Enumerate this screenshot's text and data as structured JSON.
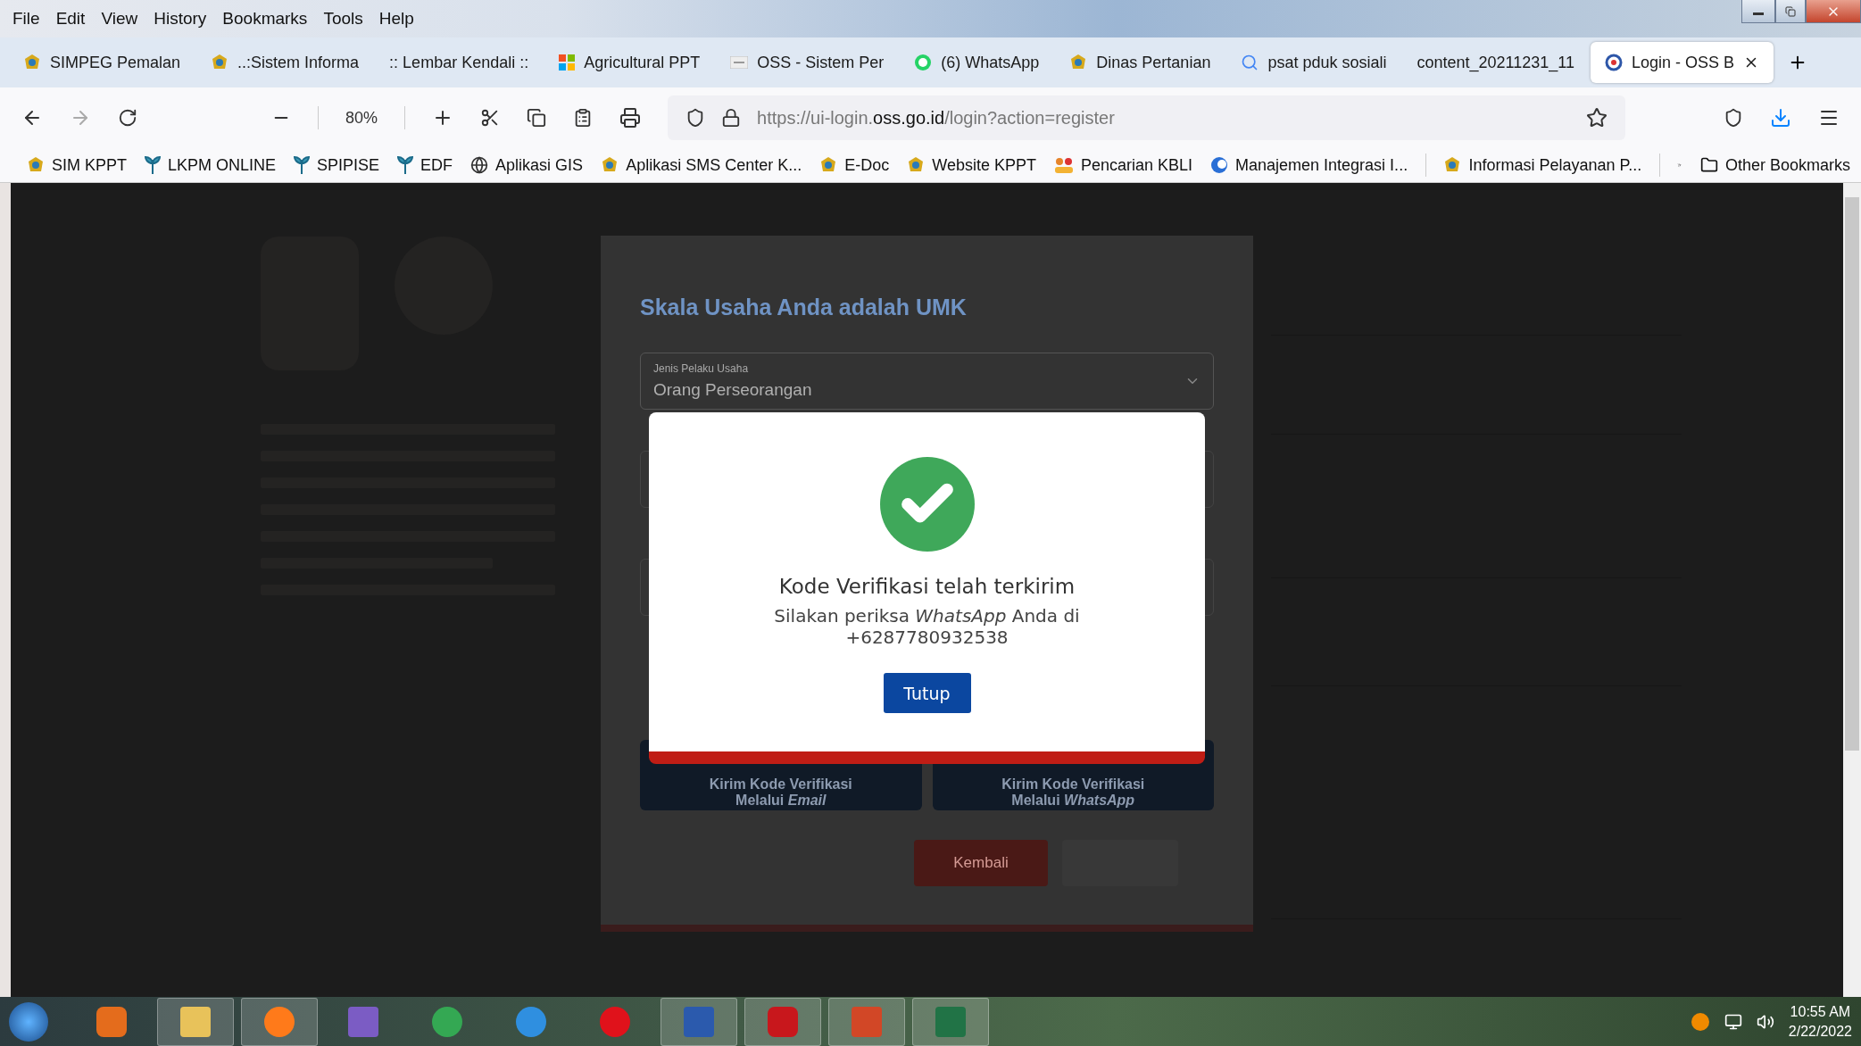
{
  "menu": [
    "File",
    "Edit",
    "View",
    "History",
    "Bookmarks",
    "Tools",
    "Help"
  ],
  "tabs": [
    {
      "label": "SIMPEG Pemalan",
      "selected": false
    },
    {
      "label": "..:Sistem Informa",
      "selected": false
    },
    {
      "label": ":: Lembar Kendali ::",
      "selected": false
    },
    {
      "label": "Agricultural PPT",
      "selected": false
    },
    {
      "label": "OSS - Sistem Per",
      "selected": false
    },
    {
      "label": "(6) WhatsApp",
      "selected": false
    },
    {
      "label": "Dinas Pertanian",
      "selected": false
    },
    {
      "label": "psat pduk sosiali",
      "selected": false
    },
    {
      "label": "content_20211231_11",
      "selected": false
    },
    {
      "label": "Login - OSS B",
      "selected": true
    }
  ],
  "zoom": "80%",
  "url": {
    "prefix": "https://ui-login.",
    "domain": "oss.go.id",
    "path": "/login?action=register"
  },
  "bookmarks": [
    "SIM KPPT",
    "LKPM ONLINE",
    "SPIPISE",
    "EDF",
    "Aplikasi GIS",
    "Aplikasi SMS Center K...",
    "E-Doc",
    "Website KPPT",
    "Pencarian KBLI",
    "Manajemen Integrasi I...",
    "Informasi Pelayanan P..."
  ],
  "other_bookmarks": "Other Bookmarks",
  "background_form": {
    "title": "Skala Usaha Anda adalah UMK",
    "field_label": "Jenis Pelaku Usaha",
    "field_value": "Orang Perseorangan",
    "send_buttons": [
      "Kirim Kode Verifikasi Melalui *Email*",
      "Kirim Kode Verifikasi Melalui *WhatsApp*"
    ],
    "back_button": "Kembali"
  },
  "dialog": {
    "title": "Kode Verifikasi telah terkirim",
    "message": "Silakan periksa *WhatsApp* Anda di",
    "phone": "+6287780932538",
    "button": "Tutup"
  },
  "taskbar": {
    "time": "10:55 AM",
    "date": "2/22/2022"
  }
}
